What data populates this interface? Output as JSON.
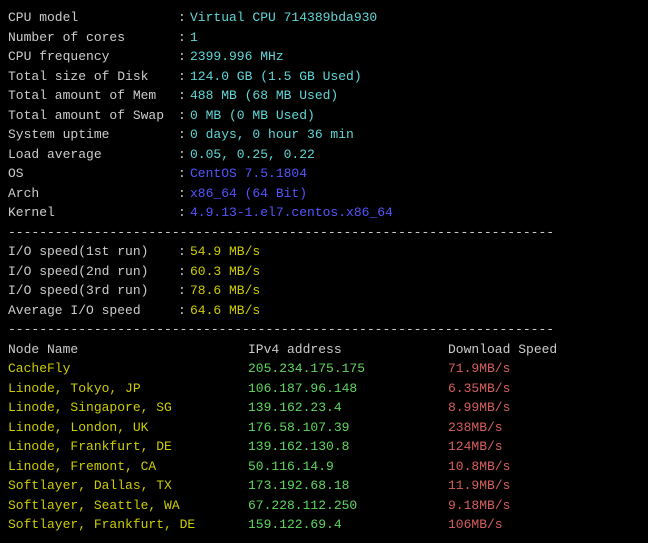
{
  "sysinfo": [
    {
      "label": "CPU model",
      "value": "Virtual CPU 714389bda930",
      "cls": "cyan"
    },
    {
      "label": "Number of cores",
      "value": "1",
      "cls": "cyan"
    },
    {
      "label": "CPU frequency",
      "value": "2399.996 MHz",
      "cls": "cyan"
    },
    {
      "label": "Total size of Disk",
      "value": "124.0 GB (1.5 GB Used)",
      "cls": "cyan"
    },
    {
      "label": "Total amount of Mem",
      "value": "488 MB (68 MB Used)",
      "cls": "cyan"
    },
    {
      "label": "Total amount of Swap",
      "value": "0 MB (0 MB Used)",
      "cls": "cyan"
    },
    {
      "label": "System uptime",
      "value": "0 days, 0 hour 36 min",
      "cls": "cyan"
    },
    {
      "label": "Load average",
      "value": "0.05, 0.25, 0.22",
      "cls": "cyan"
    },
    {
      "label": "OS",
      "value": "CentOS 7.5.1804",
      "cls": "blue"
    },
    {
      "label": "Arch",
      "value": "x86_64 (64 Bit)",
      "cls": "blue"
    },
    {
      "label": "Kernel",
      "value": "4.9.13-1.el7.centos.x86_64",
      "cls": "blue"
    }
  ],
  "iospeed": [
    {
      "label": "I/O speed(1st run)",
      "value": "54.9 MB/s"
    },
    {
      "label": "I/O speed(2nd run)",
      "value": "60.3 MB/s"
    },
    {
      "label": "I/O speed(3rd run)",
      "value": "78.6 MB/s"
    },
    {
      "label": "Average I/O speed",
      "value": "64.6 MB/s"
    }
  ],
  "nodeheader": {
    "name": "Node Name",
    "ip": "IPv4 address",
    "speed": "Download Speed"
  },
  "nodes": [
    {
      "name": "CacheFly",
      "ip": "205.234.175.175",
      "speed": "71.9MB/s"
    },
    {
      "name": "Linode, Tokyo, JP",
      "ip": "106.187.96.148",
      "speed": "6.35MB/s"
    },
    {
      "name": "Linode, Singapore, SG",
      "ip": "139.162.23.4",
      "speed": "8.99MB/s"
    },
    {
      "name": "Linode, London, UK",
      "ip": "176.58.107.39",
      "speed": "238MB/s"
    },
    {
      "name": "Linode, Frankfurt, DE",
      "ip": "139.162.130.8",
      "speed": "124MB/s"
    },
    {
      "name": "Linode, Fremont, CA",
      "ip": "50.116.14.9",
      "speed": "10.8MB/s"
    },
    {
      "name": "Softlayer, Dallas, TX",
      "ip": "173.192.68.18",
      "speed": "11.9MB/s"
    },
    {
      "name": "Softlayer, Seattle, WA",
      "ip": "67.228.112.250",
      "speed": "9.18MB/s"
    },
    {
      "name": "Softlayer, Frankfurt, DE",
      "ip": "159.122.69.4",
      "speed": "106MB/s"
    }
  ],
  "divider": "----------------------------------------------------------------------"
}
